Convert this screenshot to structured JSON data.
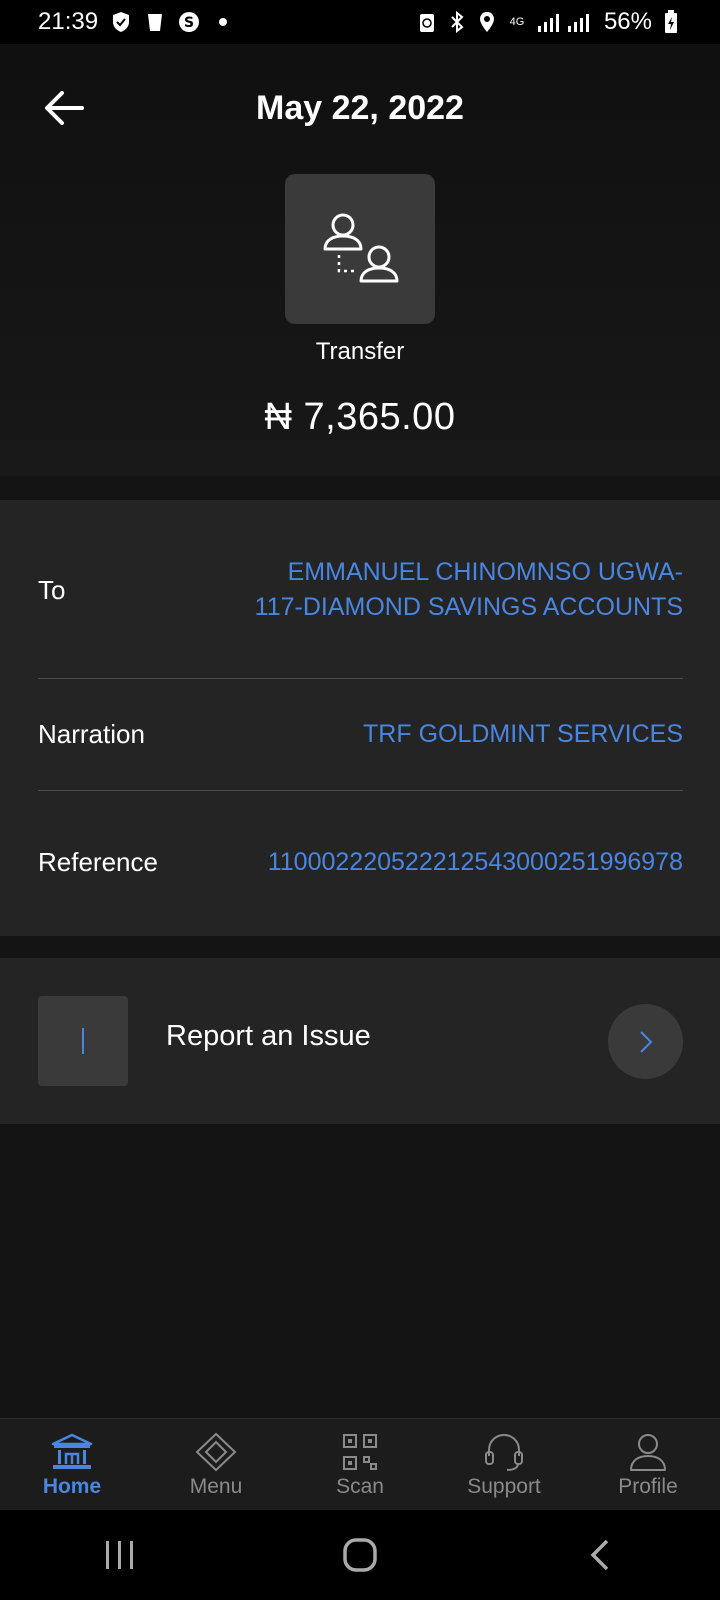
{
  "status_bar": {
    "time": "21:39",
    "battery": "56%",
    "network": "4G",
    "icons": [
      "shield-icon",
      "trash-icon",
      "s-app-icon",
      "dot-icon",
      "sync-icon",
      "bluetooth-icon",
      "location-icon",
      "signal-icon",
      "battery-icon"
    ]
  },
  "header": {
    "title": "May 22, 2022"
  },
  "transaction": {
    "type": "Transfer",
    "amount": "₦ 7,365.00",
    "icon": "transfer-users-icon"
  },
  "details": {
    "to_label": "To",
    "to_value": "EMMANUEL CHINOMNSO UGWA-117-DIAMOND SAVINGS ACCOUNTS",
    "narration_label": "Narration",
    "narration_value": "TRF GOLDMINT SERVICES",
    "reference_label": "Reference",
    "reference_value": "110002220522212543000251996978"
  },
  "report": {
    "label": "Report an Issue",
    "icon_glyph": "!"
  },
  "bottom_nav": {
    "items": [
      {
        "label": "Home",
        "icon": "bank-icon",
        "active": true
      },
      {
        "label": "Menu",
        "icon": "diamond-menu-icon",
        "active": false
      },
      {
        "label": "Scan",
        "icon": "qr-scan-icon",
        "active": false
      },
      {
        "label": "Support",
        "icon": "headset-icon",
        "active": false
      },
      {
        "label": "Profile",
        "icon": "profile-icon",
        "active": false
      }
    ]
  },
  "colors": {
    "accent": "#4a86e0",
    "background": "#141414",
    "card": "#242424"
  }
}
